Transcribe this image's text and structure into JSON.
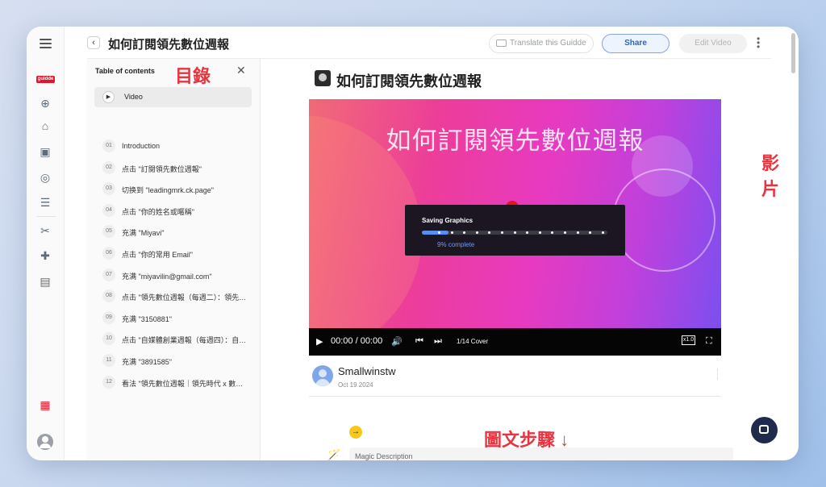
{
  "header": {
    "title": "如何訂閱領先數位週報",
    "translate_label": "Translate this Guidde",
    "share_label": "Share",
    "edit_label": "Edit Video"
  },
  "rail": {
    "logo_text": "guidde"
  },
  "toc": {
    "title": "Table of contents",
    "annotation": "目錄",
    "video_label": "Video",
    "items": [
      {
        "num": "01",
        "label": "Introduction"
      },
      {
        "num": "02",
        "label": "点击 \"訂閱領先數位週報\""
      },
      {
        "num": "03",
        "label": "切换到 \"leadingmrk.ck.page\""
      },
      {
        "num": "04",
        "label": "点击 \"你的姓名或暱稱\""
      },
      {
        "num": "05",
        "label": "充满 \"Miyavi\""
      },
      {
        "num": "06",
        "label": "点击 \"你的常用 Email\""
      },
      {
        "num": "07",
        "label": "充满 \"miyavilin@gmail.com\""
      },
      {
        "num": "08",
        "label": "点击 \"領先數位週報（每週二）：領先時代 x 數位趨勢\""
      },
      {
        "num": "09",
        "label": "充满 \"3150881\""
      },
      {
        "num": "10",
        "label": "点击 \"自媒體創業週報（每週四）：自媒體經營\""
      },
      {
        "num": "11",
        "label": "充满 \"3891585\""
      },
      {
        "num": "12",
        "label": "看法 \"領先數位週報｜領先時代 x 數位趨勢\""
      }
    ]
  },
  "main": {
    "guide_title": "如何訂閱領先數位週報",
    "video": {
      "caption": "如何訂閱領先數位週報",
      "saving_title": "Saving Graphics",
      "progress": 0.09,
      "progress_text": "9% complete",
      "time": "00:00 / 00:00",
      "chapter": "1/14 Cover",
      "speed": "x1.0"
    },
    "author": {
      "name": "Smallwinstw",
      "date": "Oct 19 2024"
    },
    "annotation_video": "影片",
    "annotation_steps": "圖文步驟 ↓",
    "magic_description": "Magic Description"
  },
  "icons": {
    "play": "▶",
    "prev": "⏮",
    "next": "⏭",
    "volume": "🔊",
    "fullscreen": "⛶",
    "close": "✕",
    "back": "‹",
    "arrow": "→",
    "wand": "🪄"
  }
}
